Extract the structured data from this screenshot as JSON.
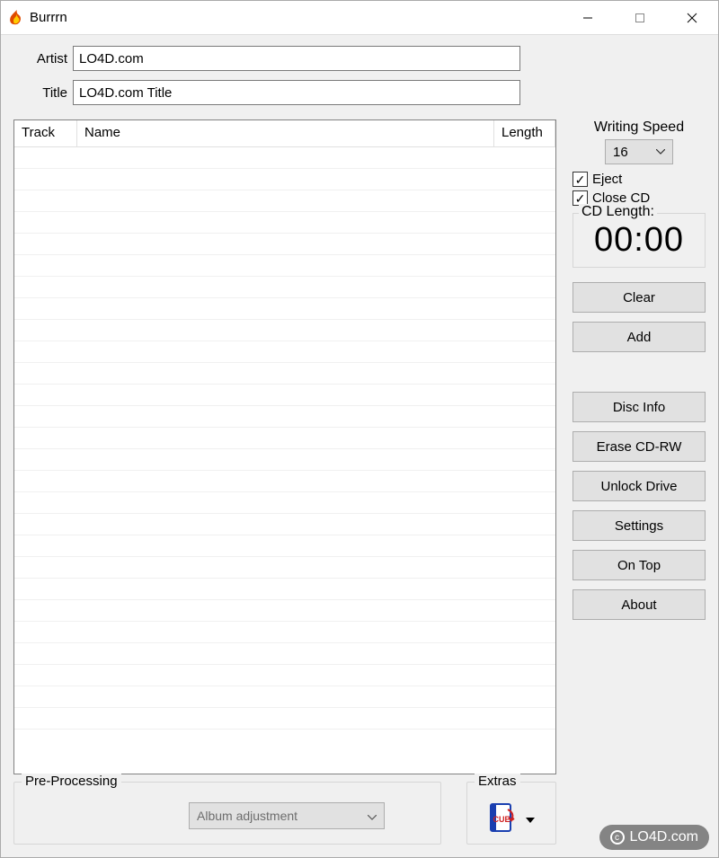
{
  "window": {
    "title": "Burrrn"
  },
  "form": {
    "artist_label": "Artist",
    "artist_value": "LO4D.com",
    "title_label": "Title",
    "title_value": "LO4D.com Title"
  },
  "table": {
    "col_track": "Track",
    "col_name": "Name",
    "col_length": "Length"
  },
  "preprocessing": {
    "group_label": "Pre-Processing",
    "dropdown_value": "Album adjustment"
  },
  "extras": {
    "group_label": "Extras"
  },
  "right": {
    "writing_speed_label": "Writing Speed",
    "writing_speed_value": "16",
    "eject_label": "Eject",
    "eject_checked": true,
    "closecd_label": "Close CD",
    "closecd_checked": true,
    "cdlength_label": "CD Length:",
    "cdlength_value": "00:00",
    "buttons": {
      "clear": "Clear",
      "add": "Add",
      "disc_info": "Disc Info",
      "erase": "Erase CD-RW",
      "unlock": "Unlock Drive",
      "settings": "Settings",
      "ontop": "On Top",
      "about": "About"
    }
  },
  "watermark": "LO4D.com"
}
